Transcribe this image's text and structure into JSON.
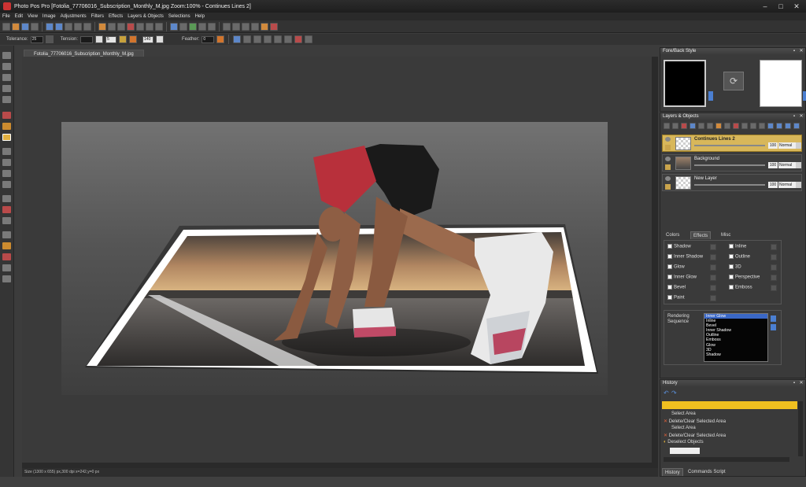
{
  "window": {
    "title": "Photo Pos Pro [Fotolia_77706016_Subscription_Monthly_M.jpg Zoom:100% - Continues Lines 2]",
    "controls": [
      "–",
      "□",
      "✕"
    ]
  },
  "menu": [
    "File",
    "Edit",
    "View",
    "Image",
    "Adjustments",
    "Filters",
    "Effects",
    "Layers & Objects",
    "Selections",
    "Help"
  ],
  "options_bar": {
    "tolerance_label": "Tolerance:",
    "tolerance_value": "25",
    "tension_label": "Tension:",
    "tension_value": "",
    "width_value": "5",
    "height_value": "140",
    "feather_label": "Feather:",
    "feather_value": "0"
  },
  "document": {
    "tab": "Fotolia_77706016_Subscription_Monthly_M.jpg",
    "status": "Size (1300 x 655) px,300 dpi   x=242,y=0 px"
  },
  "style_panel": {
    "title": "Fore/Back Style",
    "fore_color": "#000000",
    "back_color": "#ffffff"
  },
  "layers_panel": {
    "title": "Layers & Objects",
    "layers": [
      {
        "name": "Continues Lines 2",
        "opacity": "100",
        "mode": "Normal",
        "selected": true
      },
      {
        "name": "Background",
        "opacity": "100",
        "mode": "Normal",
        "selected": false
      },
      {
        "name": "New Layer",
        "opacity": "100",
        "mode": "Normal",
        "selected": false
      }
    ]
  },
  "effects_panel": {
    "tabs": [
      "Colors",
      "Effects",
      "Misc"
    ],
    "active_tab": "Effects",
    "left_effects": [
      "Shadow",
      "Inner Shadow",
      "Glow",
      "Inner Glow",
      "Bevel",
      "Paint"
    ],
    "right_effects": [
      "Inline",
      "Outline",
      "3D",
      "Perspective",
      "Emboss"
    ],
    "rendering_label_1": "Rendering",
    "rendering_label_2": "Sequence",
    "sequence": [
      "Inner Glow",
      "Inline",
      "Bevel",
      "Inner Shadow",
      "Outline",
      "Emboss",
      "Glow",
      "3D",
      "Shadow"
    ]
  },
  "history_panel": {
    "title": "History",
    "items": [
      "Select Area",
      "Delete/Clear Selected Area",
      "Select Area",
      "Delete/Clear Selected Area",
      "Deselect Objects"
    ],
    "tabs": [
      "History",
      "Commands Script"
    ]
  }
}
